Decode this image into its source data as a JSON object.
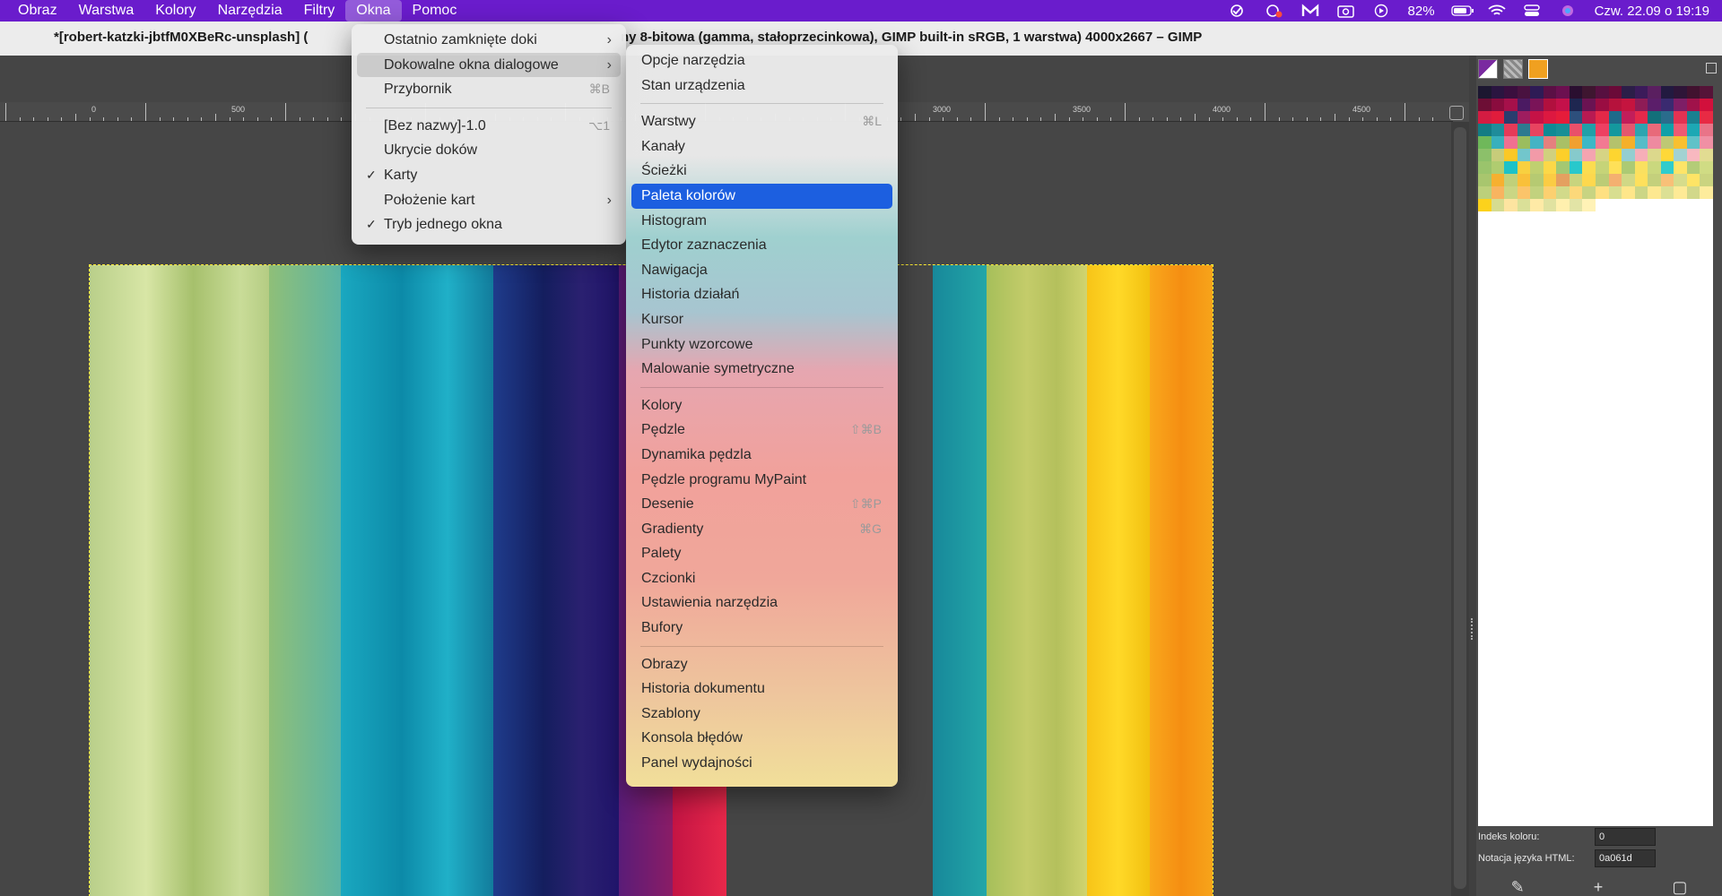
{
  "menubar": {
    "items": [
      "Obraz",
      "Warstwa",
      "Kolory",
      "Narzędzia",
      "Filtry",
      "Okna",
      "Pomoc"
    ],
    "active_index": 5,
    "battery": "82%",
    "datetime": "Czw. 22.09 o 19:19",
    "status_icons": [
      "accessibility-check-icon",
      "screen-record-icon",
      "malwarebytes-icon",
      "screenshot-icon",
      "play-icon",
      "battery-charging-icon",
      "wifi-icon",
      "control-center-icon",
      "siri-icon"
    ]
  },
  "window": {
    "title_left": "*[robert-katzki-jbtfM0XBeRc-unsplash] (",
    "title_right": "ny 8-bitowa (gamma, stałoprzecinkowa), GIMP built-in sRGB, 1 warstwa) 4000x2667 – GIMP"
  },
  "ruler": {
    "labels": [
      "0",
      "500",
      "3000",
      "3500",
      "4000",
      "4500"
    ]
  },
  "menu_okna": {
    "items": [
      {
        "label": "Ostatnio zamknięte doki",
        "submenu": true
      },
      {
        "label": "Dokowalne okna dialogowe",
        "submenu": true,
        "open": true
      },
      {
        "label": "Przybornik",
        "shortcut": "⌘B"
      },
      {
        "separator": true
      },
      {
        "label": "[Bez nazwy]-1.0",
        "shortcut": "⌥1"
      },
      {
        "label": "Ukrycie doków"
      },
      {
        "label": "Karty",
        "checked": true
      },
      {
        "label": "Położenie kart",
        "submenu": true
      },
      {
        "label": "Tryb jednego okna",
        "checked": true
      }
    ]
  },
  "menu_dialogs": {
    "items": [
      {
        "label": "Opcje narzędzia"
      },
      {
        "label": "Stan urządzenia"
      },
      {
        "separator": true
      },
      {
        "label": "Warstwy",
        "shortcut": "⌘L"
      },
      {
        "label": "Kanały"
      },
      {
        "label": "Ścieżki"
      },
      {
        "label": "Paleta kolorów",
        "highlighted": true
      },
      {
        "label": "Histogram"
      },
      {
        "label": "Edytor zaznaczenia"
      },
      {
        "label": "Nawigacja"
      },
      {
        "label": "Historia działań"
      },
      {
        "label": "Kursor"
      },
      {
        "label": "Punkty wzorcowe"
      },
      {
        "label": "Malowanie symetryczne"
      },
      {
        "separator": true
      },
      {
        "label": "Kolory"
      },
      {
        "label": "Pędzle",
        "shortcut": "⇧⌘B"
      },
      {
        "label": "Dynamika pędzla"
      },
      {
        "label": "Pędzle programu MyPaint"
      },
      {
        "label": "Desenie",
        "shortcut": "⇧⌘P"
      },
      {
        "label": "Gradienty",
        "shortcut": "⌘G"
      },
      {
        "label": "Palety"
      },
      {
        "label": "Czcionki"
      },
      {
        "label": "Ustawienia narzędzia"
      },
      {
        "label": "Bufory"
      },
      {
        "separator": true
      },
      {
        "label": "Obrazy"
      },
      {
        "label": "Historia dokumentu"
      },
      {
        "label": "Szablony"
      },
      {
        "label": "Konsola błędów"
      },
      {
        "label": "Panel wydajności"
      }
    ]
  },
  "dock": {
    "tab_icons": [
      "colormap-icon",
      "pattern-icon",
      "color-icon"
    ],
    "index_label": "Indeks koloru:",
    "index_value": "0",
    "html_label": "Notacja języka HTML:",
    "html_value": "0a061d",
    "bottom_icons": [
      "edit-color-icon",
      "add-color-icon",
      "convert-icon"
    ],
    "palette_colors": [
      "#1c1730",
      "#2a1540",
      "#3a0f3e",
      "#491240",
      "#2e1b55",
      "#5b1045",
      "#6c1050",
      "#2a0f30",
      "#3e1630",
      "#571040",
      "#6a0a38",
      "#2c1e48",
      "#3b1b5a",
      "#5a1f60",
      "#221a40",
      "#2e1538",
      "#41122f",
      "#551438",
      "#6d0e35",
      "#8a0c3e",
      "#a6104a",
      "#4b1a62",
      "#7a1458",
      "#b1103e",
      "#c4114a",
      "#1e2650",
      "#6a1352",
      "#9a0d42",
      "#b6123c",
      "#c5143f",
      "#8e1c56",
      "#5b1e6a",
      "#3a2a70",
      "#7e1e66",
      "#a0124a",
      "#d2103c",
      "#d41c42",
      "#e01c3c",
      "#2a3d6e",
      "#9e1d5f",
      "#c51246",
      "#dd1840",
      "#e61c3a",
      "#2d4f7c",
      "#b81a52",
      "#e32848",
      "#1e6a8a",
      "#c21e5a",
      "#e4294a",
      "#126f7a",
      "#2a6c8c",
      "#e33252",
      "#1a8090",
      "#e82a44",
      "#137c84",
      "#1f8c9a",
      "#e63a58",
      "#2d7a90",
      "#e84460",
      "#0e8a94",
      "#188f96",
      "#e9506a",
      "#20a0a8",
      "#ee4062",
      "#14989e",
      "#e4586e",
      "#2da5b0",
      "#e86a7a",
      "#0fa0a8",
      "#ef5a72",
      "#1da8b4",
      "#e97488",
      "#6fb85a",
      "#38b0bc",
      "#f07090",
      "#9bbd5e",
      "#44b3c4",
      "#e5807e",
      "#a9c066",
      "#f0a030",
      "#3cb8c6",
      "#f27a92",
      "#b4c26c",
      "#f5b02a",
      "#56bcc8",
      "#ee8aa0",
      "#bec874",
      "#f8c030",
      "#60c2c8",
      "#f090a4",
      "#8cc06a",
      "#c7cc7a",
      "#fbc826",
      "#72c6cc",
      "#f29aa8",
      "#d0d07e",
      "#fccf2a",
      "#86cacc",
      "#f4a4b0",
      "#d6d484",
      "#fdd530",
      "#94ced0",
      "#f6aeb8",
      "#dcd88c",
      "#fed838",
      "#a2d2d2",
      "#f8b8c0",
      "#e2dc92",
      "#9ac46c",
      "#b0cc70",
      "#1cc2c8",
      "#f8d040",
      "#c0d070",
      "#fcd848",
      "#a4c872",
      "#28c8cc",
      "#fbdc50",
      "#c6d478",
      "#fee058",
      "#acca74",
      "#fae060",
      "#cad87e",
      "#30cccc",
      "#fde468",
      "#b4cc78",
      "#d0dc84",
      "#a8c66e",
      "#f6b030",
      "#c0d07a",
      "#f9c03a",
      "#b6ca72",
      "#fbcc44",
      "#e4a060",
      "#c8d47e",
      "#fdd84e",
      "#bccc76",
      "#f4b070",
      "#d0d886",
      "#fee05c",
      "#c4d07c",
      "#f8c078",
      "#d6dc8c",
      "#fee466",
      "#cad480",
      "#bcd07a",
      "#f8b460",
      "#cad684",
      "#fbc46a",
      "#c2d27e",
      "#fcd070",
      "#d2da8a",
      "#fcd87a",
      "#c8d482",
      "#fee082",
      "#d8de90",
      "#fee68a",
      "#ccd686",
      "#fde890",
      "#dce094",
      "#feea96",
      "#d2d88a",
      "#fdec9c",
      "#fcd21c",
      "#d6dc90",
      "#fde4a0",
      "#dae098",
      "#feeaa6",
      "#e0e2a0",
      "#fff0ae",
      "#e2e4a6",
      "#fff2b6"
    ]
  }
}
